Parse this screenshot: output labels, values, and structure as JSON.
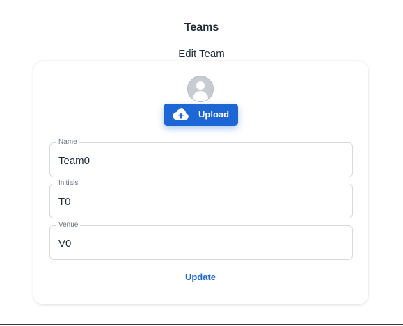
{
  "page": {
    "title": "Teams",
    "section_title": "Edit Team"
  },
  "avatar": {
    "icon": "person-icon"
  },
  "upload": {
    "label": "Upload",
    "icon": "cloud-upload-icon",
    "color": "#1d66d6"
  },
  "form": {
    "fields": [
      {
        "label": "Name",
        "value": "Team0"
      },
      {
        "label": "Initials",
        "value": "T0"
      },
      {
        "label": "Venue",
        "value": "V0"
      }
    ],
    "submit_label": "Update"
  }
}
